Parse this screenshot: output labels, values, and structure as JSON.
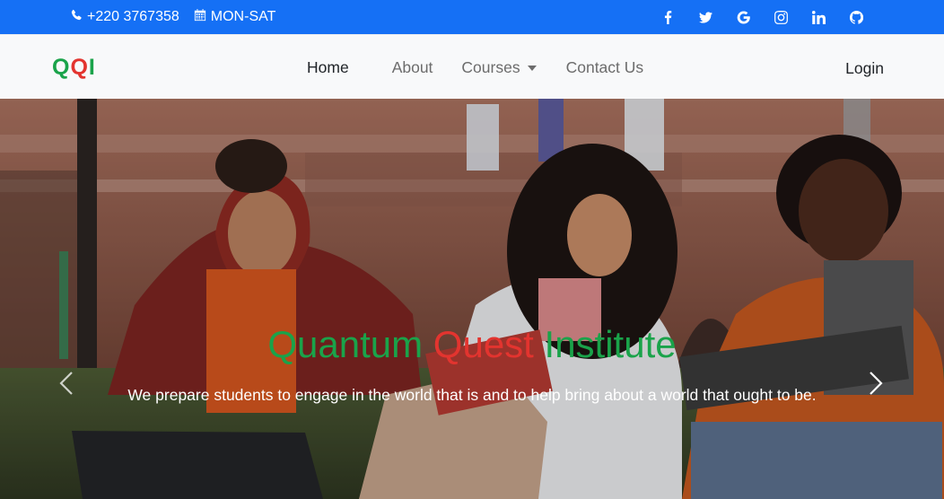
{
  "topbar": {
    "phone": "+220 3767358",
    "hours": "MON-SAT",
    "social": [
      {
        "name": "facebook-icon"
      },
      {
        "name": "twitter-icon"
      },
      {
        "name": "google-icon"
      },
      {
        "name": "instagram-icon"
      },
      {
        "name": "linkedin-icon"
      },
      {
        "name": "github-icon"
      }
    ],
    "background_color": "#1570f5"
  },
  "navbar": {
    "logo": {
      "l1": "Q",
      "l2": "Q",
      "l3": "I"
    },
    "items": [
      {
        "label": "Home"
      },
      {
        "label": "About"
      },
      {
        "label": "Courses"
      },
      {
        "label": "Contact Us"
      }
    ],
    "login_label": "Login"
  },
  "hero": {
    "title_part1": "Quantum",
    "title_part2": "Quest",
    "title_part3": "Institute",
    "subtitle": "We prepare students to engage in the world that is and to help bring about a world that ought to be.",
    "accent_green": "#1aa34a",
    "accent_red": "#e3342f"
  }
}
